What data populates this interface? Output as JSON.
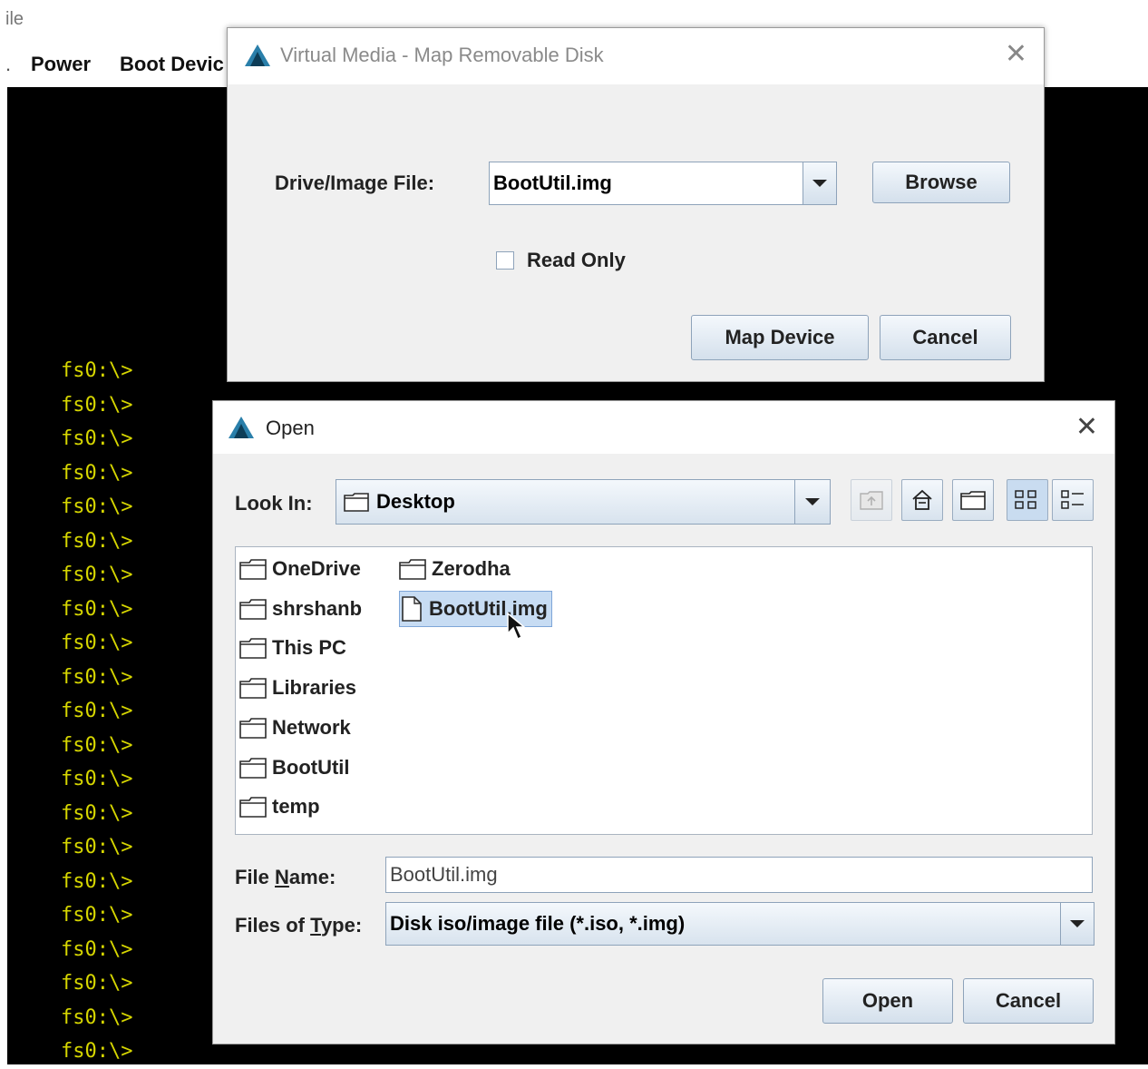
{
  "background": {
    "app_title_fragment": "ile",
    "menu": [
      "Power",
      "Boot Devic"
    ],
    "console_prompt": "fs0:\\>",
    "console_prompt_count": 21
  },
  "map_dialog": {
    "title": "Virtual Media - Map Removable Disk",
    "drive_label": "Drive/Image File:",
    "drive_value": "BootUtil.img",
    "browse_label": "Browse",
    "readonly_label": "Read Only",
    "readonly_checked": false,
    "map_label": "Map Device",
    "cancel_label": "Cancel"
  },
  "open_dialog": {
    "title": "Open",
    "lookin_label": "Look In:",
    "lookin_value": "Desktop",
    "toolbar_icons": [
      "up-one-level-icon",
      "home-icon",
      "new-folder-icon",
      "list-view-icon",
      "details-view-icon"
    ],
    "files_col1": [
      {
        "name": "OneDrive",
        "type": "folder"
      },
      {
        "name": "shrshanb",
        "type": "folder"
      },
      {
        "name": "This PC",
        "type": "folder"
      },
      {
        "name": "Libraries",
        "type": "folder"
      },
      {
        "name": "Network",
        "type": "folder"
      },
      {
        "name": "BootUtil",
        "type": "folder"
      },
      {
        "name": "temp",
        "type": "folder"
      }
    ],
    "files_col2": [
      {
        "name": "Zerodha",
        "type": "folder"
      },
      {
        "name": "BootUtil.img",
        "type": "file",
        "selected": true
      }
    ],
    "filename_label": "File Name:",
    "filename_value": "BootUtil.img",
    "filetype_label": "Files of Type:",
    "filetype_value": "Disk iso/image file (*.iso, *.img)",
    "open_label": "Open",
    "cancel_label": "Cancel"
  },
  "colors": {
    "console_bg": "#000000",
    "console_text": "#d6d600",
    "dialog_bg": "#f0f0f0",
    "selection_bg": "#c7dcf3"
  }
}
